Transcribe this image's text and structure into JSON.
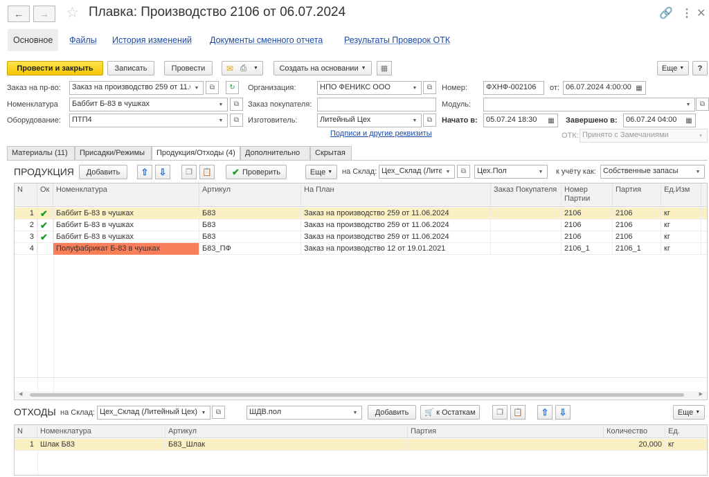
{
  "window": {
    "title": "Плавка: Производство 2106 от 06.07.2024",
    "icons": [
      "back-arrow-icon",
      "forward-arrow-icon",
      "star-icon",
      "link-icon",
      "more-vertical-icon",
      "close-icon"
    ]
  },
  "nav_tabs": [
    {
      "label": "Основное"
    },
    {
      "label": "Файлы"
    },
    {
      "label": "История изменений"
    },
    {
      "label": "Документы сменного отчета"
    },
    {
      "label": "Результаты Проверок ОТК"
    }
  ],
  "toolbar": {
    "post_close": "Провести и закрыть",
    "write": "Записать",
    "post": "Провести",
    "create_based": "Создать на основании",
    "more": "Еще",
    "help": "?"
  },
  "header": {
    "order_label": "Заказ на пр-во:",
    "order_value": "Заказ на производство 259 от 11.06.2024",
    "nomen_label": "Номенклатура",
    "nomen_value": "Баббит Б-83 в чушках",
    "equip_label": "Оборудование:",
    "equip_value": "ПТП4",
    "org_label": "Организация:",
    "org_value": "НПО ФЕНИКС ООО",
    "client_order_label": "Заказ покупателя:",
    "client_order_value": "",
    "maker_label": "Изготовитель:",
    "maker_value": "Литейный Цех",
    "signatures_link": "Подписи и другие реквизиты",
    "number_label": "Номер:",
    "number_value": "ФХНФ-002106",
    "from_label": "от:",
    "from_value": "06.07.2024  4:00:00",
    "module_label": "Модуль:",
    "module_value": "",
    "started_label": "Начато в:",
    "started_value": "05.07.24 18:30",
    "finished_label": "Завершено в:",
    "finished_value": "06.07.24 04:00",
    "otk_label": "ОТК:",
    "otk_value": "Принято с Замечаниями"
  },
  "sub_tabs": [
    {
      "label": "Материалы (11)"
    },
    {
      "label": "Присадки/Режимы"
    },
    {
      "label": "Продукция/Отходы (4)"
    },
    {
      "label": "Дополнительно"
    },
    {
      "label": "Скрытая"
    }
  ],
  "production": {
    "title": "ПРОДУКЦИЯ",
    "add": "Добавить",
    "check": "Проверить",
    "more": "Еще",
    "warehouse_label": "на Склад:",
    "warehouse_value": "Цех_Склад (Литейный Цех)",
    "place_value": "Цех.Пол",
    "account_label": "к учёту как:",
    "account_value": "Собственные запасы",
    "columns": [
      "N",
      "Ок",
      "Номенклатура",
      "Артикул",
      "На План",
      "Заказ Покупателя",
      "Номер Партии",
      "Партия",
      "Ед.Изм"
    ],
    "rows": [
      {
        "n": "1",
        "ok": "✔",
        "nomen": "Баббит Б-83 в чушках",
        "art": "Б83",
        "plan": "Заказ на производство 259 от 11.06.2024",
        "client": "",
        "batch_no": "2106",
        "batch": "2106",
        "unit": "кг"
      },
      {
        "n": "2",
        "ok": "✔",
        "nomen": "Баббит Б-83 в чушках",
        "art": "Б83",
        "plan": "Заказ на производство 259 от 11.06.2024",
        "client": "",
        "batch_no": "2106",
        "batch": "2106",
        "unit": "кг"
      },
      {
        "n": "3",
        "ok": "✔",
        "nomen": "Баббит Б-83 в чушках",
        "art": "Б83",
        "plan": "Заказ на производство 259 от 11.06.2024",
        "client": "",
        "batch_no": "2106",
        "batch": "2106",
        "unit": "кг"
      },
      {
        "n": "4",
        "ok": "",
        "nomen": "Полуфабрикат Б-83 в чушках",
        "art": "Б83_ПФ",
        "plan": "Заказ на производство 12 от 19.01.2021",
        "client": "",
        "batch_no": "2106_1",
        "batch": "2106_1",
        "unit": "кг"
      }
    ]
  },
  "waste": {
    "title": "ОТХОДЫ",
    "warehouse_label": "на Склад:",
    "warehouse_value": "Цех_Склад (Литейный Цех)",
    "place_value": "ШДВ.пол",
    "add": "Добавить",
    "to_rests": "к Остаткам",
    "more": "Еще",
    "columns": [
      "N",
      "Номенклатура",
      "Артикул",
      "Партия",
      "Количество",
      "Ед."
    ],
    "rows": [
      {
        "n": "1",
        "nomen": "Шлак Б83",
        "art": "Б83_Шлак",
        "batch": "",
        "qty": "20,000",
        "unit": "кг"
      }
    ]
  },
  "colors": {
    "accent_yellow": "#f5c800",
    "link_blue": "#1a4aa8",
    "selected_row": "#fbf0c4",
    "warning_cell": "#f97e5a",
    "check_green": "#1c9a2a"
  }
}
